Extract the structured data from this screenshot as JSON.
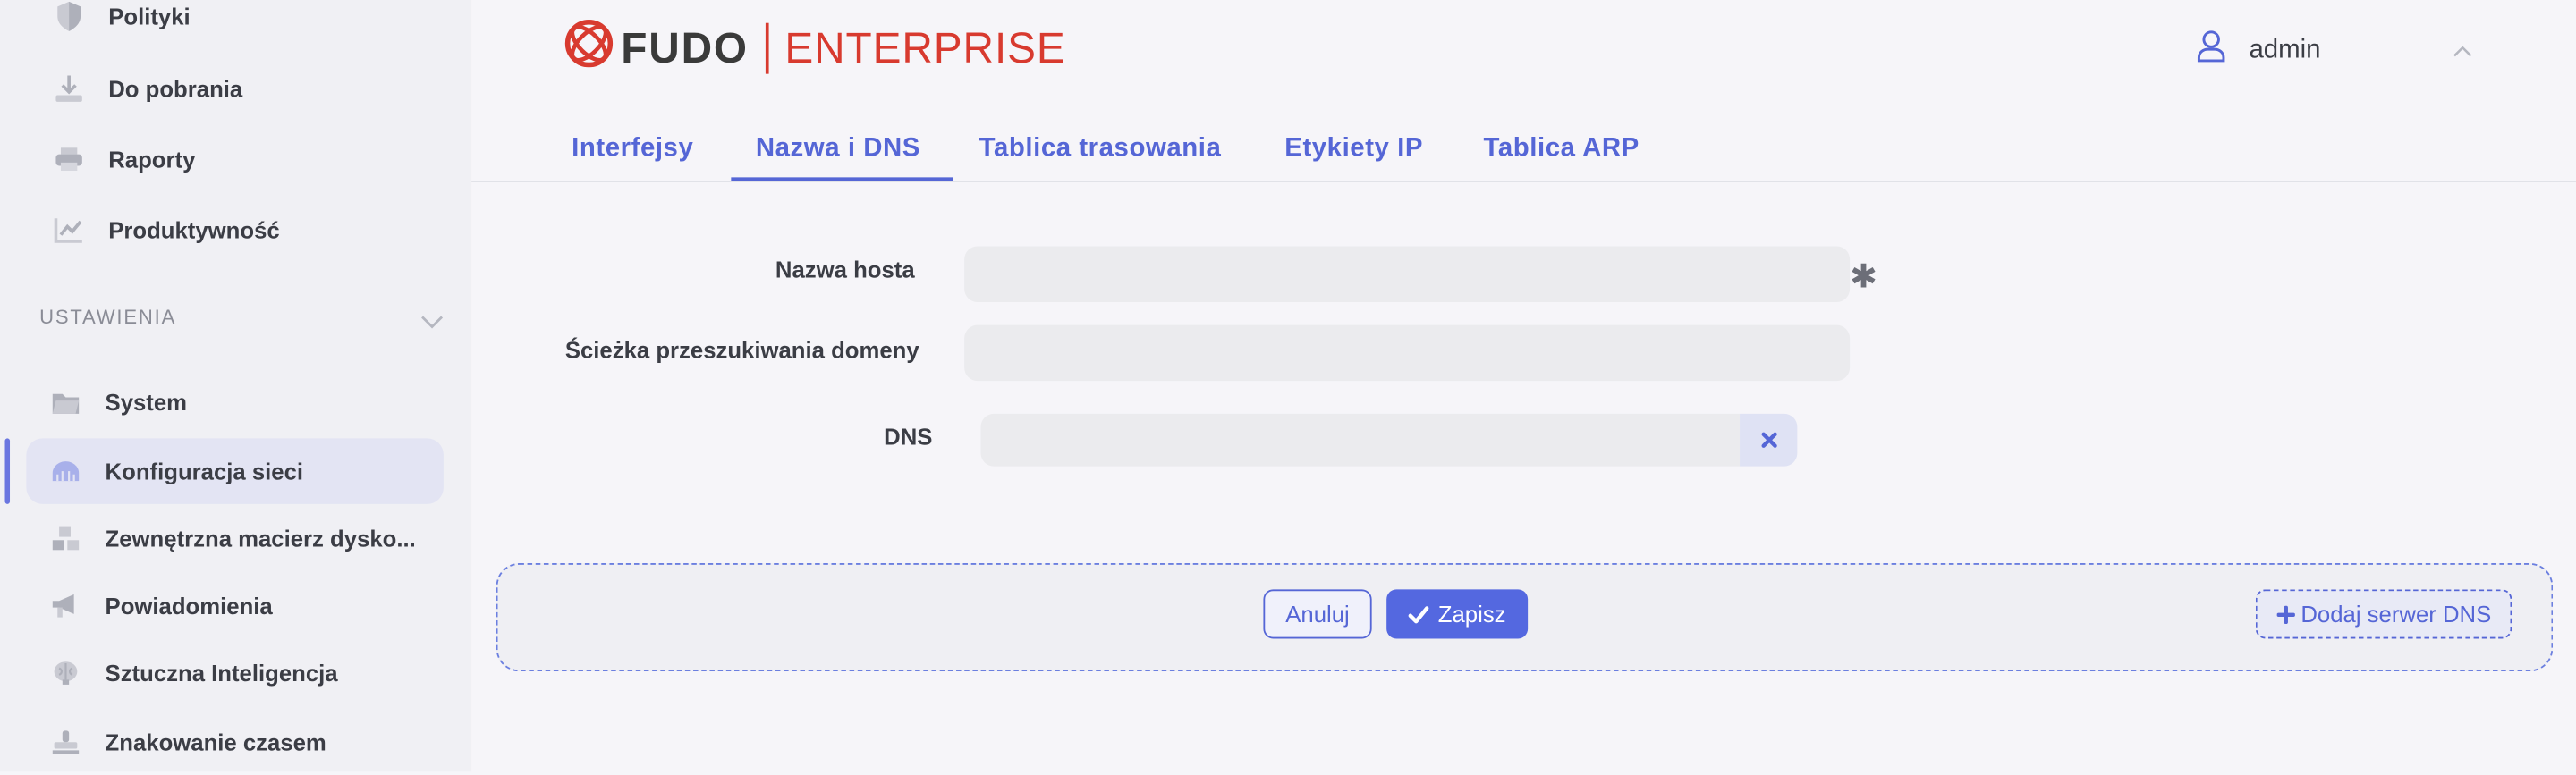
{
  "sidebar": {
    "top_items": [
      {
        "label": "Polityki",
        "icon": "shield-icon"
      },
      {
        "label": "Do pobrania",
        "icon": "download-icon"
      },
      {
        "label": "Raporty",
        "icon": "printer-icon"
      },
      {
        "label": "Produktywność",
        "icon": "chart-line-icon"
      }
    ],
    "section_title": "USTAWIENIA",
    "settings_items": [
      {
        "label": "System",
        "icon": "folder-icon"
      },
      {
        "label": "Konfiguracja sieci",
        "icon": "network-icon",
        "active": true
      },
      {
        "label": "Zewnętrzna macierz dysko...",
        "icon": "storage-icon"
      },
      {
        "label": "Powiadomienia",
        "icon": "megaphone-icon"
      },
      {
        "label": "Sztuczna Inteligencja",
        "icon": "brain-icon"
      },
      {
        "label": "Znakowanie czasem",
        "icon": "stamp-icon"
      }
    ]
  },
  "header": {
    "logo_fudo": "FUDO",
    "logo_enterprise": "ENTERPRISE",
    "user_name": "admin"
  },
  "tabs": [
    {
      "label": "Interfejsy"
    },
    {
      "label": "Nazwa i DNS",
      "active": true
    },
    {
      "label": "Tablica trasowania"
    },
    {
      "label": "Etykiety IP"
    },
    {
      "label": "Tablica ARP"
    }
  ],
  "form": {
    "hostname_label": "Nazwa hosta",
    "hostname_value": "",
    "required_mark": "✱",
    "search_domain_label": "Ścieżka przeszukiwania domeny",
    "search_domain_value": "",
    "dns_label": "DNS",
    "dns_value": ""
  },
  "footer": {
    "cancel_label": "Anuluj",
    "save_label": "Zapisz",
    "add_dns_label": "Dodaj serwer DNS"
  },
  "colors": {
    "accent": "#5566d6",
    "brand_red": "#d83a2f",
    "active_nav_bg": "#e3e4f3"
  }
}
